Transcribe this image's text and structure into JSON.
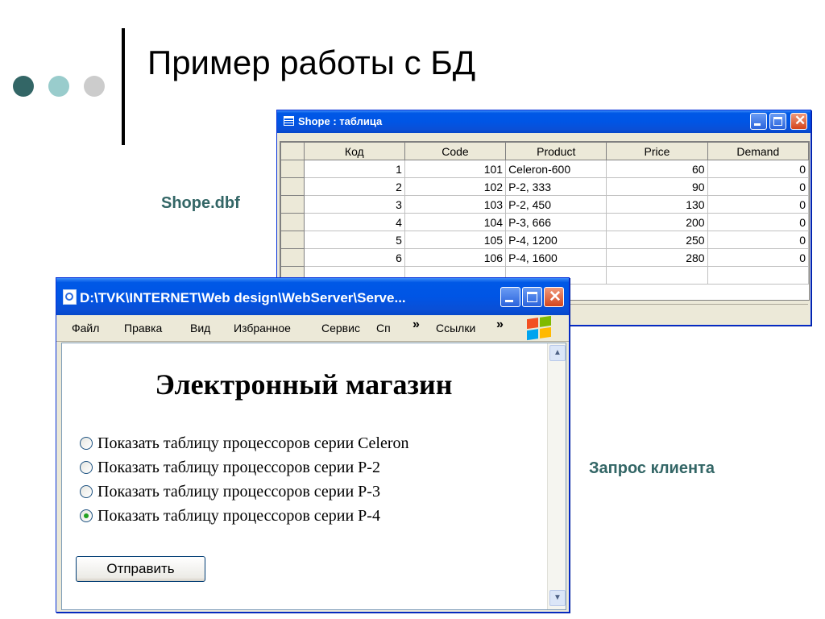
{
  "slide": {
    "title": "Пример работы с БД",
    "caption_table": "Shope.dbf",
    "caption_request": "Запрос клиента",
    "dot_colors": [
      "#336666",
      "#99cccc",
      "#cccccc"
    ]
  },
  "table_window": {
    "title": "Shope : таблица",
    "columns": [
      "Код",
      "Code",
      "Product",
      "Price",
      "Demand"
    ],
    "rows": [
      [
        "1",
        "101",
        "Celeron-600",
        "60",
        "0"
      ],
      [
        "2",
        "102",
        "P-2, 333",
        "90",
        "0"
      ],
      [
        "3",
        "103",
        "P-2, 450",
        "130",
        "0"
      ],
      [
        "4",
        "104",
        "P-3, 666",
        "200",
        "0"
      ],
      [
        "5",
        "105",
        "P-4, 1200",
        "250",
        "0"
      ],
      [
        "6",
        "106",
        "P-4, 1600",
        "280",
        "0"
      ]
    ]
  },
  "browser_window": {
    "title": "D:\\TVK\\INTERNET\\Web design\\WebServer\\Serve...",
    "menu": [
      "Файл",
      "Правка",
      "Вид",
      "Избранное",
      "Сервис",
      "Сп"
    ],
    "chevron": "»",
    "links_label": "Ссылки",
    "page_heading": "Электронный магазин",
    "options": [
      {
        "label": "Показать таблицу процессоров серии Celeron",
        "checked": false
      },
      {
        "label": "Показать таблицу процессоров серии P-2",
        "checked": false
      },
      {
        "label": "Показать таблицу процессоров серии P-3",
        "checked": false
      },
      {
        "label": "Показать таблицу процессоров серии P-4",
        "checked": true
      }
    ],
    "submit_label": "Отправить"
  }
}
